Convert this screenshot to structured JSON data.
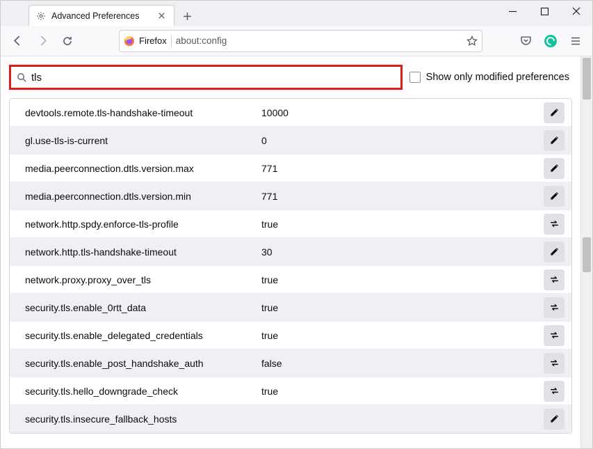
{
  "window": {
    "tab_title": "Advanced Preferences"
  },
  "urlbar": {
    "identity_label": "Firefox",
    "url": "about:config"
  },
  "search": {
    "value": "tls",
    "checkbox_label": "Show only modified preferences"
  },
  "prefs": [
    {
      "name": "devtools.remote.tls-handshake-timeout",
      "value": "10000",
      "action": "edit"
    },
    {
      "name": "gl.use-tls-is-current",
      "value": "0",
      "action": "edit"
    },
    {
      "name": "media.peerconnection.dtls.version.max",
      "value": "771",
      "action": "edit"
    },
    {
      "name": "media.peerconnection.dtls.version.min",
      "value": "771",
      "action": "edit"
    },
    {
      "name": "network.http.spdy.enforce-tls-profile",
      "value": "true",
      "action": "toggle"
    },
    {
      "name": "network.http.tls-handshake-timeout",
      "value": "30",
      "action": "edit"
    },
    {
      "name": "network.proxy.proxy_over_tls",
      "value": "true",
      "action": "toggle"
    },
    {
      "name": "security.tls.enable_0rtt_data",
      "value": "true",
      "action": "toggle"
    },
    {
      "name": "security.tls.enable_delegated_credentials",
      "value": "true",
      "action": "toggle"
    },
    {
      "name": "security.tls.enable_post_handshake_auth",
      "value": "false",
      "action": "toggle"
    },
    {
      "name": "security.tls.hello_downgrade_check",
      "value": "true",
      "action": "toggle"
    },
    {
      "name": "security.tls.insecure_fallback_hosts",
      "value": "",
      "action": "edit"
    }
  ]
}
